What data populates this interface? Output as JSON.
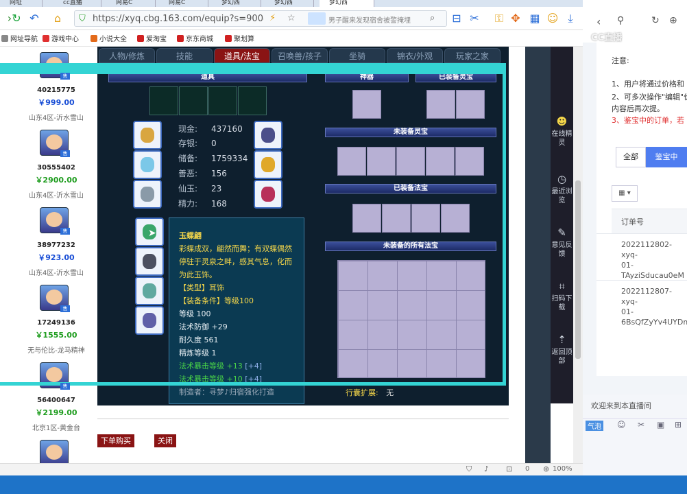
{
  "browser": {
    "tabs": [
      "网址",
      "cc直播",
      "网易C",
      "网易C",
      "梦幻西",
      "梦幻西",
      "梦幻西"
    ],
    "url": "https://xyq.cbg.163.com/equip?s=900&eid",
    "news": "男子醒来发现宿舍被警掩埋",
    "bookmarks": [
      "网址导航",
      "游戏中心",
      "小说大全",
      "爱淘宝",
      "京东商城",
      "聚划算"
    ],
    "zoom": "100%",
    "status_count": "0"
  },
  "listing": [
    {
      "id": "40215775",
      "price": "￥999.00",
      "server": "山东4区-沂水雪山",
      "price_color": "#1a4fd6"
    },
    {
      "id": "30555402",
      "price": "￥2900.00",
      "server": "山东4区-沂水雪山",
      "price_color": "#1f9d1f"
    },
    {
      "id": "38977232",
      "price": "￥923.00",
      "server": "山东4区-沂水雪山",
      "price_color": "#1a4fd6"
    },
    {
      "id": "17249136",
      "price": "￥1555.00",
      "server": "无与伦比-龙马精神",
      "price_color": "#1f9d1f"
    },
    {
      "id": "56400647",
      "price": "￥2199.00",
      "server": "北京1区-黄金台",
      "price_color": "#1f9d1f"
    }
  ],
  "listing_tag": "售",
  "game": {
    "tabs": [
      "人物/修炼",
      "技能",
      "道具/法宝",
      "召唤兽/孩子",
      "坐骑",
      "锦衣/外观",
      "玩家之家"
    ],
    "active_tab": 2,
    "section_daoju": "道具",
    "section_shenqi": "神器",
    "section_equipped_lingbao": "已装备灵宝",
    "section_unequipped_lingbao": "未装备灵宝",
    "section_equipped_fabao": "已装备法宝",
    "section_unequipped_fabao": "未装备的所有法宝",
    "stats": [
      {
        "label": "现金:",
        "value": "437160"
      },
      {
        "label": "存银:",
        "value": "0"
      },
      {
        "label": "储备:",
        "value": "1759334"
      },
      {
        "label": "善恶:",
        "value": "156"
      },
      {
        "label": "仙玉:",
        "value": "23"
      },
      {
        "label": "精力:",
        "value": "168"
      }
    ],
    "xingnang_label": "行囊扩展:",
    "xingnang_value": "无",
    "buy_button": "下单购买",
    "close_button": "关闭"
  },
  "tooltip": {
    "title": "玉蝶翩",
    "desc": "彩蝶成双，翩然而舞；有双蝶偶然停驻于灵泉之畔，感其气息，化而为此玉饰。",
    "type": "【类型】耳饰",
    "req": "【装备条件】等级100",
    "level": "等级 100",
    "mdef": "法术防御 +29",
    "dur": "耐久度 561",
    "refine": "精炼等级 1",
    "crit1_label": "法术暴击等级 +13",
    "crit1_bonus": "[+4]",
    "crit2_label": "法术暴击等级 +10",
    "crit2_bonus": "[+4]",
    "maker": "制造者：寻梦♪归宿强化打造"
  },
  "right_toolbar": [
    {
      "icon": "spirit-icon",
      "label": "在线精灵"
    },
    {
      "icon": "clock-icon",
      "label": "最近浏览"
    },
    {
      "icon": "edit-icon",
      "label": "意见反馈"
    },
    {
      "icon": "scan-icon",
      "label": "扫码下载"
    },
    {
      "icon": "top-icon",
      "label": "返回顶部"
    }
  ],
  "right_panel": {
    "notice_title": "注意:",
    "notice_1": "1、用户将通过价格和",
    "notice_2": "2、可多次操作\"编辑\"价",
    "notice_2b": "内容后再次提。",
    "notice_3": "3、鉴宝中的订单，若",
    "filter_all": "全部",
    "filter_active": "鉴宝中",
    "col_order": "订单号",
    "orders": [
      {
        "line1": "2022112802-xyq-",
        "line2": "01-",
        "line3": "TAyziSducau0eM"
      },
      {
        "line1": "2022112807-xyq-",
        "line2": "01-",
        "line3": "6BsQfZyYv4UYDm"
      }
    ],
    "welcome": "欢迎来到本直播间",
    "bubble": "气泡",
    "watermark": "CC直播"
  },
  "colors": {
    "accent_red": "#8a1414",
    "cyan_frame": "#34d4d4",
    "blue_button": "#4f7df0"
  }
}
